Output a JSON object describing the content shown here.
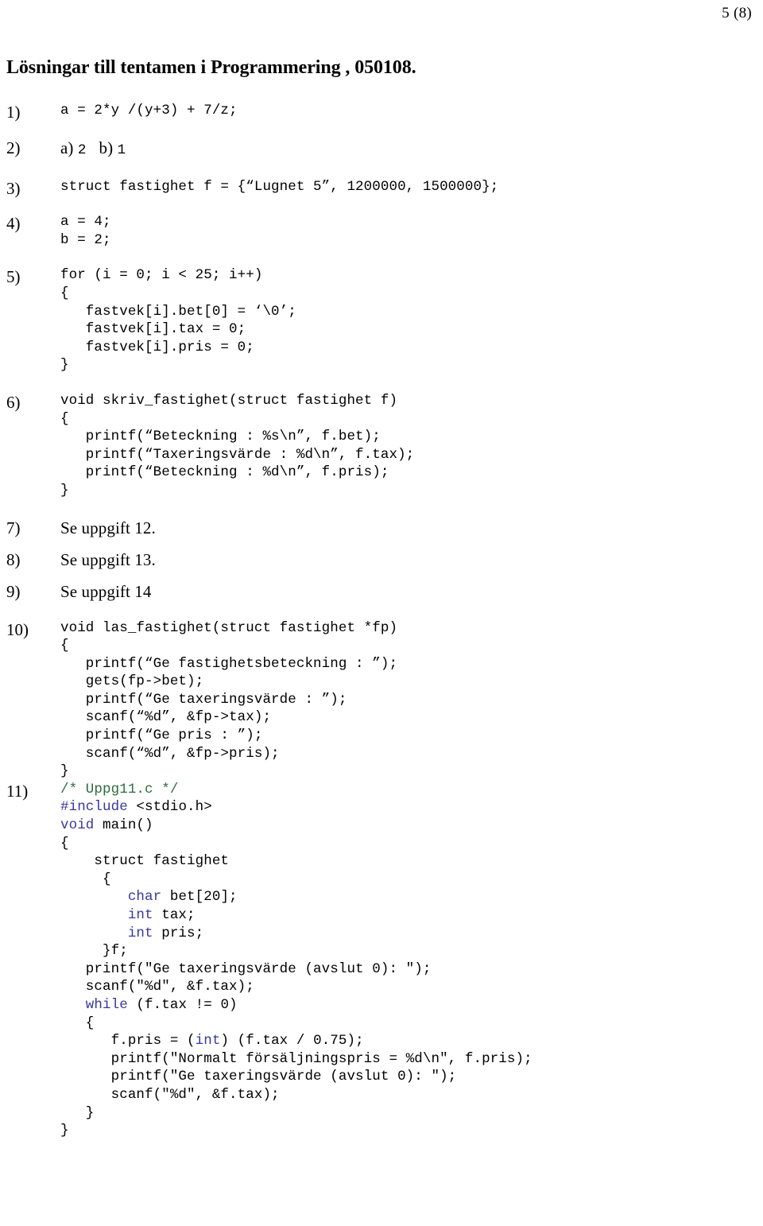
{
  "header": {
    "page_number": "5 (8)"
  },
  "title": "Lösningar till tentamen i Programmering , 050108.",
  "colors": {
    "comment": "#2e6b3e",
    "keyword": "#3838a0",
    "text": "#000000",
    "background": "#ffffff"
  },
  "items": [
    {
      "label": "1)",
      "style": "code",
      "lines": [
        [
          {
            "t": "a = 2*y /(y+3) + 7/z;",
            "c": "plain"
          }
        ]
      ],
      "gap": "gap-md"
    },
    {
      "label": "2)",
      "style": "mixed",
      "mixed_parts": [
        {
          "t": "a) ",
          "c": "serif"
        },
        {
          "t": "2",
          "c": "mono"
        },
        {
          "t": "   b) ",
          "c": "serif"
        },
        {
          "t": "1",
          "c": "mono"
        }
      ],
      "gap": "gap-md"
    },
    {
      "label": "3)",
      "style": "code",
      "lines": [
        [
          {
            "t": "struct fastighet f = {“Lugnet 5”, 1200000, 1500000};",
            "c": "plain"
          }
        ]
      ],
      "gap": "gap-md"
    },
    {
      "label": "4)",
      "style": "code",
      "lines": [
        [
          {
            "t": "a = 4;",
            "c": "plain"
          }
        ],
        [
          {
            "t": "b = 2;",
            "c": "plain"
          }
        ]
      ],
      "gap": "gap-md"
    },
    {
      "label": "5)",
      "style": "code",
      "lines": [
        [
          {
            "t": "for (i = 0; i < 25; i++)",
            "c": "plain"
          }
        ],
        [
          {
            "t": "{",
            "c": "plain"
          }
        ],
        [
          {
            "t": "   fastvek[i].bet[0] = ‘\\0’;",
            "c": "plain"
          }
        ],
        [
          {
            "t": "   fastvek[i].tax = 0;",
            "c": "plain"
          }
        ],
        [
          {
            "t": "   fastvek[i].pris = 0;",
            "c": "plain"
          }
        ],
        [
          {
            "t": "}",
            "c": "plain"
          }
        ]
      ],
      "gap": "gap-md"
    },
    {
      "label": "6)",
      "style": "code",
      "lines": [
        [
          {
            "t": "void skriv_fastighet(struct fastighet f)",
            "c": "plain"
          }
        ],
        [
          {
            "t": "{",
            "c": "plain"
          }
        ],
        [
          {
            "t": "   printf(“Beteckning : %s\\n”, f.bet);",
            "c": "plain"
          }
        ],
        [
          {
            "t": "   printf(“Taxeringsvärde : %d\\n”, f.tax);",
            "c": "plain"
          }
        ],
        [
          {
            "t": "   printf(“Beteckning : %d\\n”, f.pris);",
            "c": "plain"
          }
        ],
        [
          {
            "t": "}",
            "c": "plain"
          }
        ]
      ],
      "gap": "gap-md"
    },
    {
      "label": "7)",
      "style": "prose",
      "lines": [
        [
          {
            "t": "Se uppgift 12.",
            "c": "plain"
          }
        ]
      ],
      "gap": "gap-sm"
    },
    {
      "label": "8)",
      "style": "prose",
      "lines": [
        [
          {
            "t": "Se uppgift 13.",
            "c": "plain"
          }
        ]
      ],
      "gap": "gap-sm"
    },
    {
      "label": "9)",
      "style": "prose",
      "lines": [
        [
          {
            "t": "Se uppgift 14",
            "c": "plain"
          }
        ]
      ],
      "gap": "gap-md"
    },
    {
      "label": "10)",
      "style": "code",
      "lines": [
        [
          {
            "t": "void las_fastighet(struct fastighet *fp)",
            "c": "plain"
          }
        ],
        [
          {
            "t": "{",
            "c": "plain"
          }
        ],
        [
          {
            "t": "   printf(“Ge fastighetsbeteckning : ”);",
            "c": "plain"
          }
        ],
        [
          {
            "t": "   gets(fp->bet);",
            "c": "plain"
          }
        ],
        [
          {
            "t": "   printf(“Ge taxeringsvärde : ”);",
            "c": "plain"
          }
        ],
        [
          {
            "t": "   scanf(“%d”, &fp->tax);",
            "c": "plain"
          }
        ],
        [
          {
            "t": "   printf(“Ge pris : ”);",
            "c": "plain"
          }
        ],
        [
          {
            "t": "   scanf(“%d”, &fp->pris);",
            "c": "plain"
          }
        ],
        [
          {
            "t": "}",
            "c": "plain"
          }
        ]
      ],
      "gap": "none"
    },
    {
      "label": "11)",
      "style": "code",
      "lines": [
        [
          {
            "t": "/* Uppg11.c */",
            "c": "comment"
          }
        ],
        [
          {
            "t": "#include",
            "c": "keyword"
          },
          {
            "t": " <stdio.h>",
            "c": "plain"
          }
        ],
        [
          {
            "t": "void",
            "c": "keyword"
          },
          {
            "t": " main()",
            "c": "plain"
          }
        ],
        [
          {
            "t": "{",
            "c": "plain"
          }
        ],
        [
          {
            "t": "    struct fastighet",
            "c": "plain"
          }
        ],
        [
          {
            "t": "     {",
            "c": "plain"
          }
        ],
        [
          {
            "t": "        char",
            "c": "keyword"
          },
          {
            "t": " bet[20];",
            "c": "plain"
          }
        ],
        [
          {
            "t": "        int",
            "c": "keyword"
          },
          {
            "t": " tax;",
            "c": "plain"
          }
        ],
        [
          {
            "t": "        int",
            "c": "keyword"
          },
          {
            "t": " pris;",
            "c": "plain"
          }
        ],
        [
          {
            "t": "     }f;",
            "c": "plain"
          }
        ],
        [
          {
            "t": "   printf(\"Ge taxeringsvärde (avslut 0): \");",
            "c": "plain"
          }
        ],
        [
          {
            "t": "   scanf(\"%d\", &f.tax);",
            "c": "plain"
          }
        ],
        [
          {
            "t": "   while",
            "c": "keyword"
          },
          {
            "t": " (f.tax != 0)",
            "c": "plain"
          }
        ],
        [
          {
            "t": "   {",
            "c": "plain"
          }
        ],
        [
          {
            "t": "      f.pris = (",
            "c": "plain"
          },
          {
            "t": "int",
            "c": "keyword"
          },
          {
            "t": ") (f.tax / 0.75);",
            "c": "plain"
          }
        ],
        [
          {
            "t": "      printf(\"Normalt försäljningspris = %d\\n\", f.pris);",
            "c": "plain"
          }
        ],
        [
          {
            "t": "      printf(\"Ge taxeringsvärde (avslut 0): \");",
            "c": "plain"
          }
        ],
        [
          {
            "t": "      scanf(\"%d\", &f.tax);",
            "c": "plain"
          }
        ],
        [
          {
            "t": "   }",
            "c": "plain"
          }
        ],
        [
          {
            "t": "}",
            "c": "plain"
          }
        ]
      ],
      "gap": "none"
    }
  ]
}
